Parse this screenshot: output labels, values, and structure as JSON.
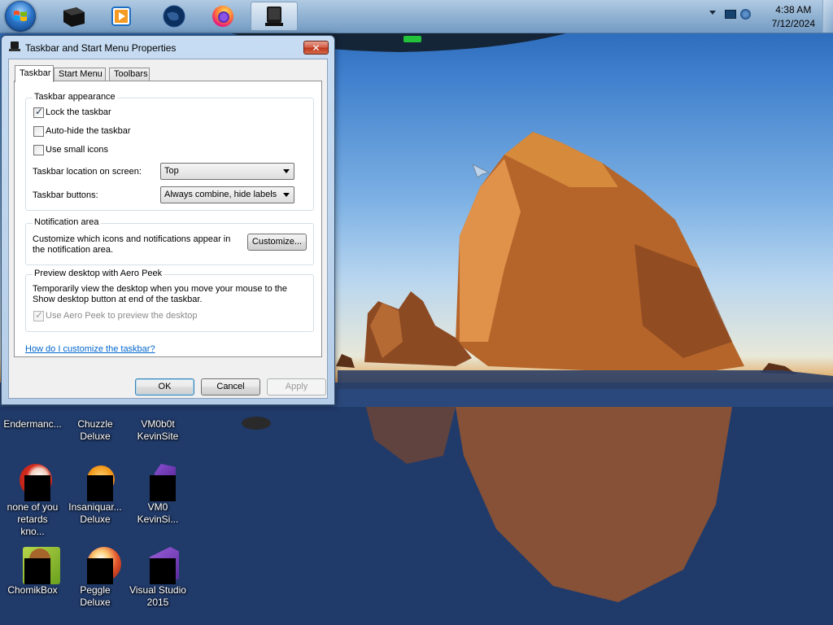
{
  "taskbar": {
    "pinned": [
      {
        "name": "black-app-icon"
      },
      {
        "name": "media-player-icon"
      },
      {
        "name": "globe-icon"
      },
      {
        "name": "firefox-icon"
      },
      {
        "name": "taskbar-properties-icon",
        "active": true
      }
    ],
    "tray": {
      "show_hidden_icon": "chevron-up-icon",
      "network_icon": "network-icon",
      "volume_icon": "speaker-icon",
      "time": "4:38 AM",
      "date": "7/12/2024"
    }
  },
  "dialog": {
    "title": "Taskbar and Start Menu Properties",
    "close_label": "✕",
    "tabs": [
      {
        "label": "Taskbar",
        "selected": true
      },
      {
        "label": "Start Menu",
        "selected": false
      },
      {
        "label": "Toolbars",
        "selected": false
      }
    ],
    "appearance": {
      "heading": "Taskbar appearance",
      "lock_label": "Lock the taskbar",
      "lock_checked": true,
      "autohide_label": "Auto-hide the taskbar",
      "autohide_checked": false,
      "small_icons_label": "Use small icons",
      "small_icons_checked": false,
      "location_label": "Taskbar location on screen:",
      "location_value": "Top",
      "buttons_label": "Taskbar buttons:",
      "buttons_value": "Always combine, hide labels"
    },
    "notification": {
      "heading": "Notification area",
      "description": "Customize which icons and notifications appear in the notification area.",
      "customize_label": "Customize..."
    },
    "aero_peek": {
      "heading": "Preview desktop with Aero Peek",
      "description": "Temporarily view the desktop when you move your mouse to the Show desktop button at end of the taskbar.",
      "use_label": "Use Aero Peek to preview the desktop",
      "use_checked": true,
      "use_enabled": false
    },
    "help_link": "How do I customize the taskbar?",
    "ok_label": "OK",
    "cancel_label": "Cancel",
    "apply_label": "Apply"
  },
  "desktop_icons": [
    {
      "label": "Endermanc...",
      "icon": "app-icon"
    },
    {
      "label": "Chuzzle Deluxe",
      "icon": "chuzzle-icon"
    },
    {
      "label": "VM0b0t KevinSite",
      "icon": "app-icon"
    },
    {
      "label": "none of you retards kno...",
      "icon": "red-app-icon"
    },
    {
      "label": "Insaniquar... Deluxe",
      "icon": "insaniquarium-icon"
    },
    {
      "label": "VM0 KevinSi...",
      "icon": "purple-app-icon"
    },
    {
      "label": "ChomikBox",
      "icon": "chomikbox-icon"
    },
    {
      "label": "Peggle Deluxe",
      "icon": "peggle-icon"
    },
    {
      "label": "Visual Studio 2015",
      "icon": "visual-studio-icon"
    }
  ]
}
